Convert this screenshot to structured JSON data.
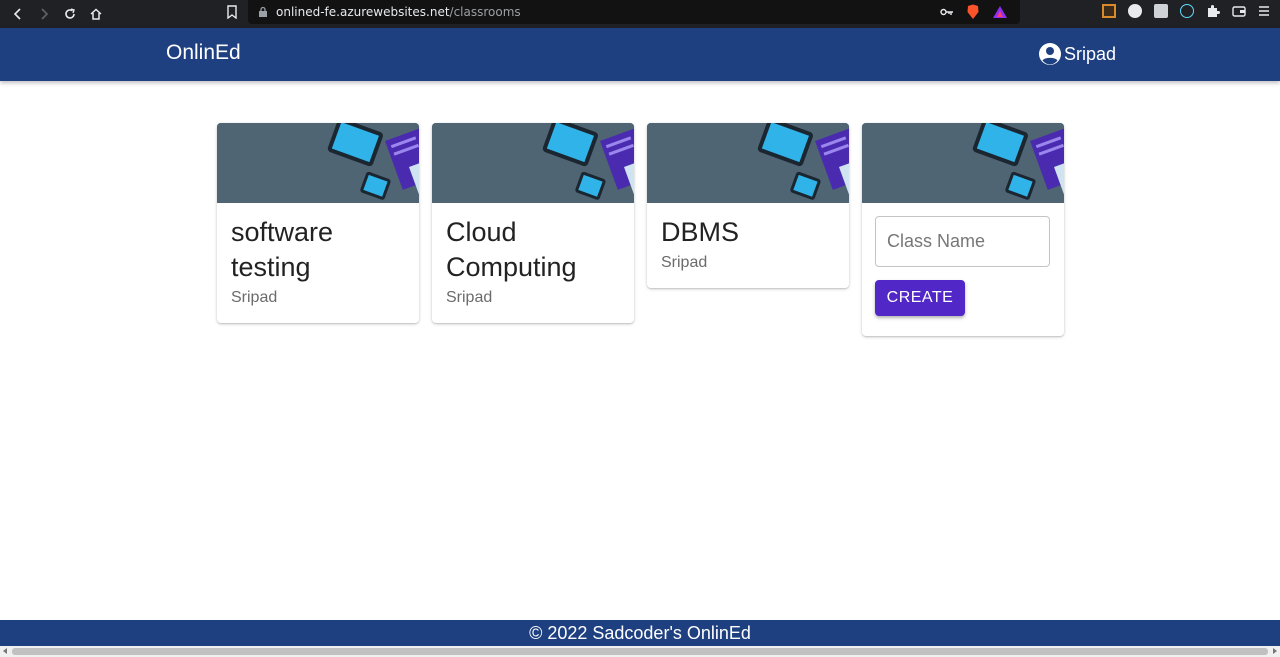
{
  "browser": {
    "url_host": "onlined-fe.azurewebsites.net",
    "url_path": "/classrooms"
  },
  "header": {
    "brand": "OnlinEd",
    "user_name": "Sripad"
  },
  "classes": [
    {
      "name": "software testing",
      "owner": "Sripad"
    },
    {
      "name": "Cloud Computing",
      "owner": "Sripad"
    },
    {
      "name": "DBMS",
      "owner": "Sripad"
    }
  ],
  "create_card": {
    "input_placeholder": "Class Name",
    "input_value": "",
    "button_label": "CREATE"
  },
  "footer": {
    "text": "© 2022 Sadcoder's OnlinEd"
  },
  "colors": {
    "appbar": "#1e4080",
    "create_button": "#5227c7",
    "banner": "#4f6574"
  }
}
